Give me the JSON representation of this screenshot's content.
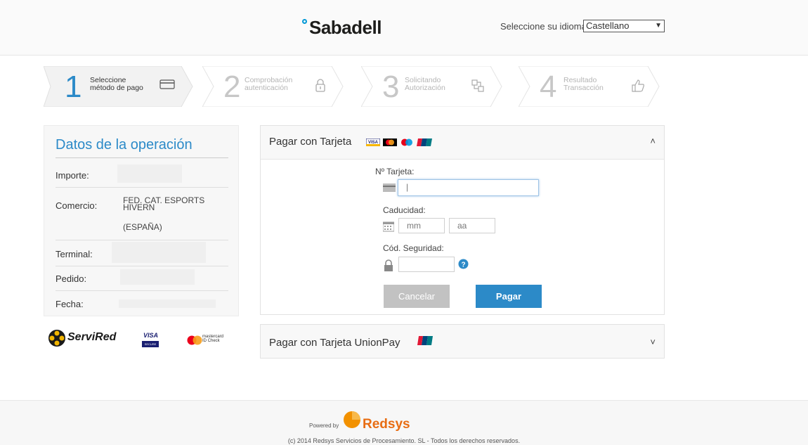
{
  "header": {
    "logo_text": "Sabadell",
    "language_label": "Seleccione su idioma",
    "language_selected": "Castellano"
  },
  "steps": [
    {
      "number": "1",
      "line1": "Seleccione",
      "line2": "método de pago",
      "icon": "credit-card-icon",
      "active": true
    },
    {
      "number": "2",
      "line1": "Comprobación",
      "line2": "autenticación",
      "icon": "lock-icon",
      "active": false
    },
    {
      "number": "3",
      "line1": "Solicitando",
      "line2": "Autorización",
      "icon": "transfer-icon",
      "active": false
    },
    {
      "number": "4",
      "line1": "Resultado",
      "line2": "Transacción",
      "icon": "thumbs-up-icon",
      "active": false
    }
  ],
  "operation": {
    "title": "Datos de la operación",
    "importe_label": "Importe:",
    "comercio_label": "Comercio:",
    "comercio_value_line1": "FED. CAT. ESPORTS",
    "comercio_value_line2": "HIVERN",
    "comercio_value_line3": "(ESPAÑA)",
    "terminal_label": "Terminal:",
    "pedido_label": "Pedido:",
    "fecha_label": "Fecha:"
  },
  "brands": {
    "servired": "ServiRed",
    "visa": "VISA",
    "visa_sub": "SECURE",
    "mastercard_line1": "mastercard",
    "mastercard_line2": "ID Check"
  },
  "card_payment": {
    "title": "Pagar con Tarjeta",
    "card_number_label": "Nº Tarjeta:",
    "card_number_value": "|",
    "expiry_label": "Caducidad:",
    "month_placeholder": "mm",
    "year_placeholder": "aa",
    "cvv_label": "Cód. Seguridad:",
    "cancel_label": "Cancelar",
    "pay_label": "Pagar"
  },
  "unionpay": {
    "title": "Pagar con Tarjeta UnionPay"
  },
  "footer": {
    "powered_by": "Powered by",
    "brand": "Redsys",
    "copyright": "(c) 2014 Redsys Servicios de Procesamiento. SL - Todos los derechos reservados."
  },
  "colors": {
    "accent": "#2c8ac8",
    "redsys_orange": "#e86d13",
    "cancel_gray": "#c2c2c2"
  }
}
